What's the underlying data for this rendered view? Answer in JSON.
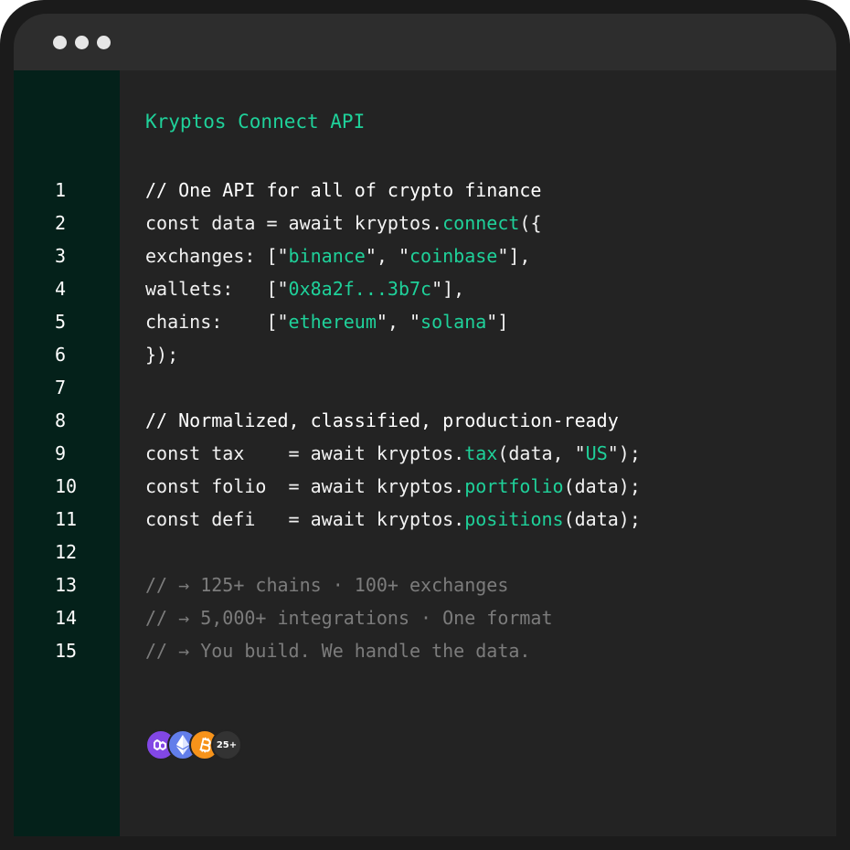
{
  "window": {
    "controls": [
      "dot",
      "dot",
      "dot"
    ]
  },
  "editor": {
    "title": "Kryptos Connect API",
    "line_numbers": [
      "1",
      "2",
      "3",
      "4",
      "5",
      "6",
      "7",
      "8",
      "9",
      "10",
      "11",
      "12",
      "13",
      "14",
      "15"
    ],
    "lines": [
      {
        "style": "comment",
        "tokens": [
          {
            "t": "// One API for all of crypto finance",
            "c": "plain"
          }
        ]
      },
      {
        "style": "code",
        "tokens": [
          {
            "t": "const data = await kryptos.",
            "c": "plain"
          },
          {
            "t": "connect",
            "c": "green"
          },
          {
            "t": "({",
            "c": "plain"
          }
        ]
      },
      {
        "style": "code",
        "tokens": [
          {
            "t": "exchanges: [\"",
            "c": "plain"
          },
          {
            "t": "binance",
            "c": "green"
          },
          {
            "t": "\", \"",
            "c": "plain"
          },
          {
            "t": "coinbase",
            "c": "green"
          },
          {
            "t": "\"],",
            "c": "plain"
          }
        ]
      },
      {
        "style": "code",
        "tokens": [
          {
            "t": "wallets:   [\"",
            "c": "plain"
          },
          {
            "t": "0x8a2f...3b7c",
            "c": "green"
          },
          {
            "t": "\"],",
            "c": "plain"
          }
        ]
      },
      {
        "style": "code",
        "tokens": [
          {
            "t": "chains:    [\"",
            "c": "plain"
          },
          {
            "t": "ethereum",
            "c": "green"
          },
          {
            "t": "\", \"",
            "c": "plain"
          },
          {
            "t": "solana",
            "c": "green"
          },
          {
            "t": "\"]",
            "c": "plain"
          }
        ]
      },
      {
        "style": "code",
        "tokens": [
          {
            "t": "});",
            "c": "plain"
          }
        ]
      },
      {
        "style": "code",
        "tokens": [
          {
            "t": "",
            "c": "plain"
          }
        ]
      },
      {
        "style": "comment",
        "tokens": [
          {
            "t": "// Normalized, classified, production-ready",
            "c": "plain"
          }
        ]
      },
      {
        "style": "code",
        "tokens": [
          {
            "t": "const tax    = await kryptos.",
            "c": "plain"
          },
          {
            "t": "tax",
            "c": "green"
          },
          {
            "t": "(data, \"",
            "c": "plain"
          },
          {
            "t": "US",
            "c": "green"
          },
          {
            "t": "\");",
            "c": "plain"
          }
        ]
      },
      {
        "style": "code",
        "tokens": [
          {
            "t": "const folio  = await kryptos.",
            "c": "plain"
          },
          {
            "t": "portfolio",
            "c": "green"
          },
          {
            "t": "(data);",
            "c": "plain"
          }
        ]
      },
      {
        "style": "code",
        "tokens": [
          {
            "t": "const defi   = await kryptos.",
            "c": "plain"
          },
          {
            "t": "positions",
            "c": "green"
          },
          {
            "t": "(data);",
            "c": "plain"
          }
        ]
      },
      {
        "style": "code",
        "tokens": [
          {
            "t": "",
            "c": "plain"
          }
        ]
      },
      {
        "style": "muted",
        "tokens": [
          {
            "t": "// → 125+ chains · 100+ exchanges",
            "c": "plain"
          }
        ]
      },
      {
        "style": "muted",
        "tokens": [
          {
            "t": "// → 5,000+ integrations · One format",
            "c": "plain"
          }
        ]
      },
      {
        "style": "muted",
        "tokens": [
          {
            "t": "// → You build. We handle the data.",
            "c": "plain"
          }
        ]
      }
    ]
  },
  "badges": {
    "items": [
      {
        "icon": "polygon-icon",
        "color": "#8247e5"
      },
      {
        "icon": "ethereum-icon",
        "color": "#627eea"
      },
      {
        "icon": "bitcoin-icon",
        "color": "#f7931a"
      }
    ],
    "more": {
      "label": "25+",
      "color": "#333333"
    }
  },
  "colors": {
    "accent": "#1fd19a",
    "background": "#232323",
    "gutter": "#04211a",
    "titlebar": "#2d2d2d",
    "muted": "#7c7c7c"
  }
}
